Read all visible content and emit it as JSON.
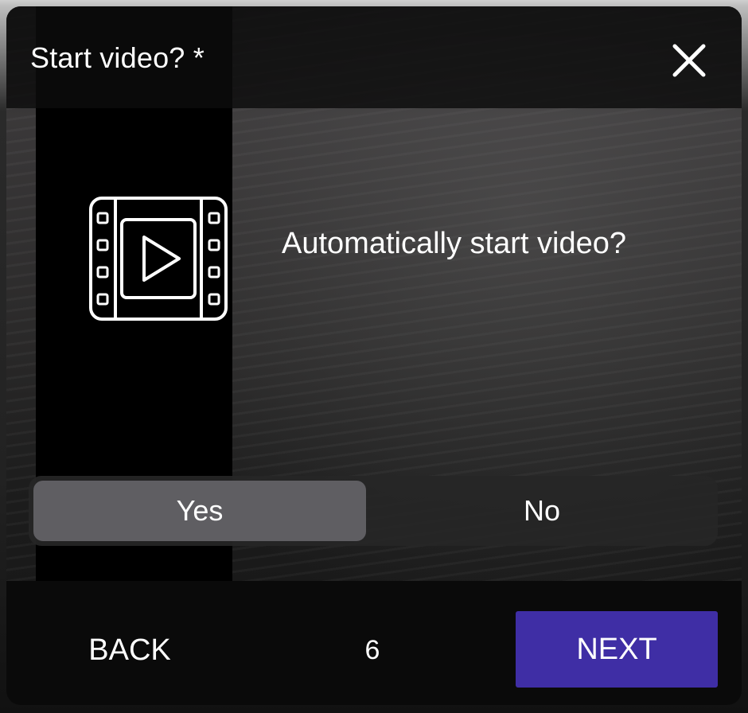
{
  "dialog": {
    "title": "Start video? *",
    "question": "Automatically start video?",
    "icons": {
      "close": "close-icon",
      "illustration": "film-play-icon"
    }
  },
  "toggle": {
    "options": [
      "Yes",
      "No"
    ],
    "selected": "Yes"
  },
  "footer": {
    "back_label": "BACK",
    "page_number": "6",
    "next_label": "NEXT"
  },
  "colors": {
    "accent": "#3f2ea5",
    "selected_option": "#5f5e62",
    "text": "#ffffff"
  }
}
